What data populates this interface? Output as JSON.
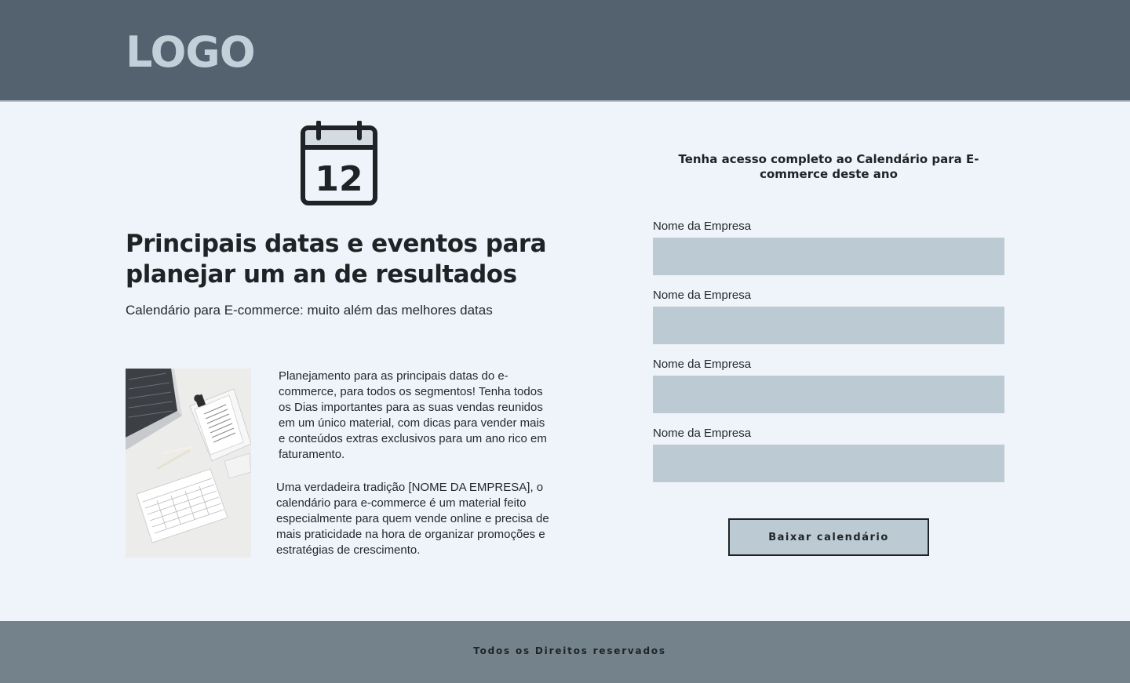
{
  "header": {
    "logo_text": "LOGO"
  },
  "hero": {
    "icon": "calendar-icon",
    "calendar_day": "12",
    "headline": "Principais datas e eventos para planejar um an de resultados",
    "subtitle": "Calendário para E-commerce: muito além das melhores datas"
  },
  "content": {
    "image": "desk-laptop-planner-photo",
    "paragraph_1": "Planejamento para as principais datas do e-commerce, para todos os segmentos! Tenha todos os Dias importantes para as suas vendas reunidos em um único material, com dicas para vender mais e conteúdos extras exclusivos para um ano rico em faturamento.",
    "paragraph_2": "Uma verdadeira tradição [NOME DA EMPRESA], o calendário para e-commerce é um material feito especialmente para quem vende online e precisa de mais praticidade na hora de organizar promoções e estratégias de crescimento."
  },
  "form": {
    "title": "Tenha acesso completo ao Calendário para E-commerce deste ano",
    "fields": [
      {
        "label": "Nome da Empresa",
        "value": ""
      },
      {
        "label": "Nome da Empresa",
        "value": ""
      },
      {
        "label": "Nome da Empresa",
        "value": ""
      },
      {
        "label": "Nome da Empresa",
        "value": ""
      }
    ],
    "submit_label": "Baixar calendário"
  },
  "footer": {
    "text": "Todos os Direitos reservados"
  },
  "colors": {
    "header_bg": "#53626e",
    "logo": "#c2d0da",
    "page_bg": "#eef4f9",
    "input_bg": "#bccbd3",
    "footer_bg": "#74838b",
    "text": "#1f2326"
  }
}
